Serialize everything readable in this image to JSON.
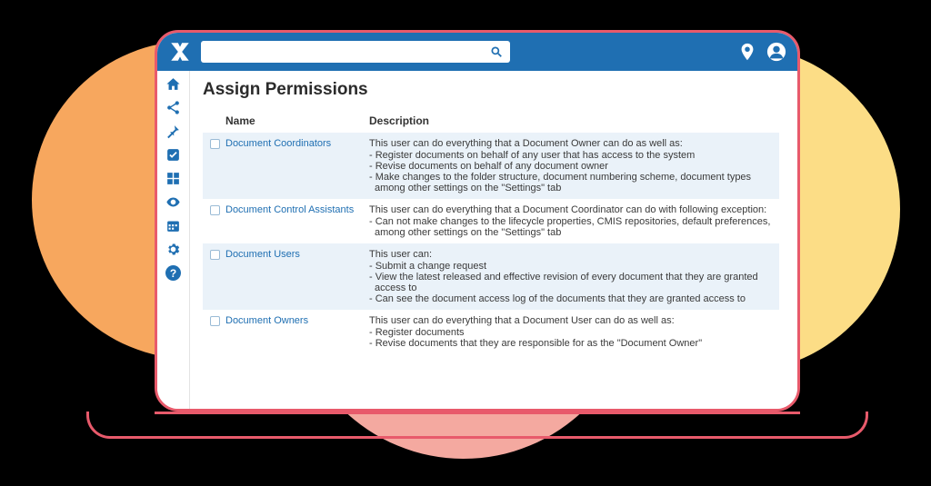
{
  "search": {
    "placeholder": ""
  },
  "page": {
    "title": "Assign Permissions"
  },
  "table": {
    "headers": {
      "name": "Name",
      "description": "Description"
    },
    "rows": [
      {
        "role": "Document Coordinators",
        "lead": "This user can do everything that a Document Owner can do as well as:",
        "lines": [
          "- Register documents on behalf of any user that has access to the system",
          "- Revise documents on behalf of any document owner",
          "- Make changes to the folder structure, document numbering scheme, document types among other settings on the \"Settings\" tab"
        ]
      },
      {
        "role": "Document Control Assistants",
        "lead": "This user can do everything that a Document Coordinator can do with following exception:",
        "lines": [
          "- Can not make changes to the lifecycle properties, CMIS repositories, default preferences, among other settings on the \"Settings\" tab"
        ]
      },
      {
        "role": "Document Users",
        "lead": "This user can:",
        "lines": [
          "- Submit a change request",
          "- View the latest released and effective revision of every document that they are granted access to",
          "- Can see the document access log of the documents that they are granted access to"
        ]
      },
      {
        "role": "Document Owners",
        "lead": "This user can do everything that a Document User can do as well as:",
        "lines": [
          "- Register documents",
          "- Revise documents that they are responsible for as the \"Document Owner\""
        ]
      }
    ]
  }
}
